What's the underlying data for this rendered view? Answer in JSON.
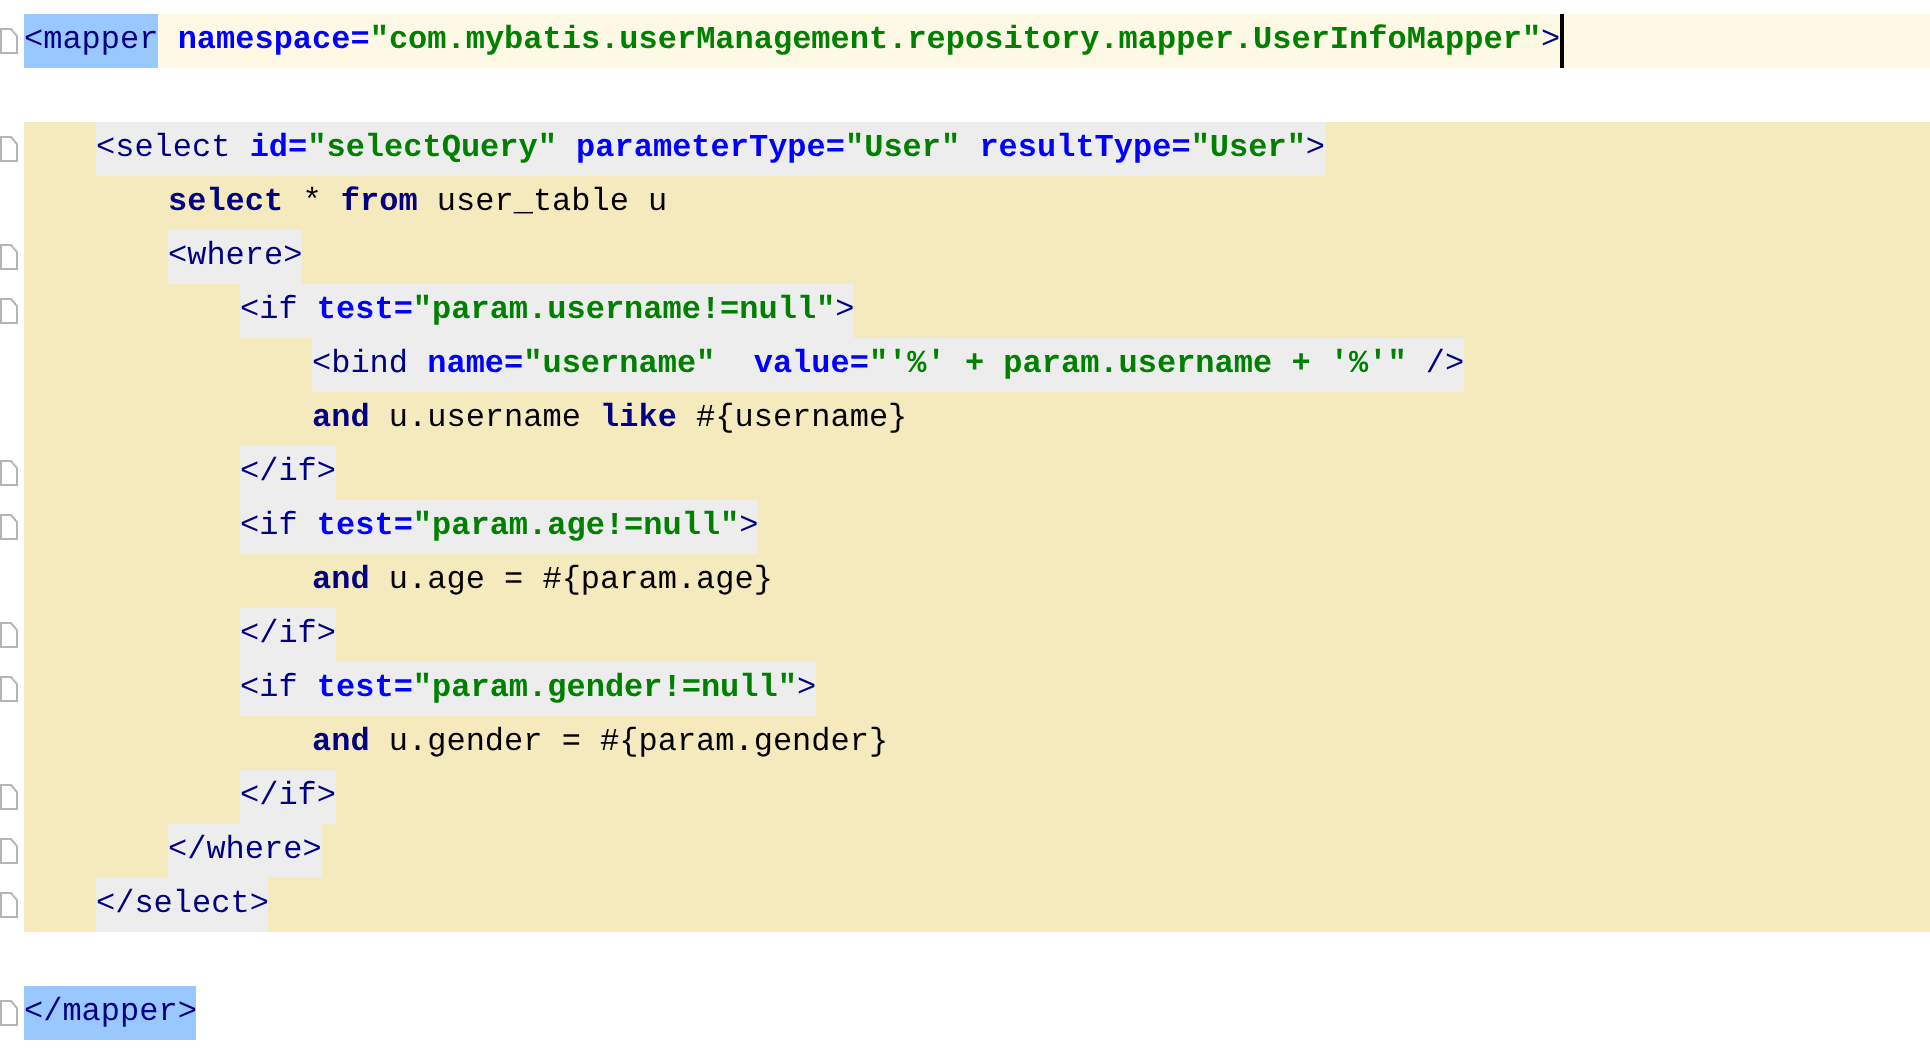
{
  "lines": [
    {
      "current": true,
      "block": false,
      "fold_marker": true,
      "caret": true,
      "matched": true,
      "tokens": [
        {
          "kind": "tag",
          "text": "<mapper"
        },
        {
          "kind": "attr",
          "text": " namespace="
        },
        {
          "kind": "string",
          "text": "\"com.mybatis.userManagement.repository.mapper.UserInfoMapper\""
        },
        {
          "kind": "tag",
          "text": ">"
        }
      ],
      "children": [
        {
          "current": false,
          "block": false,
          "fold_marker": false,
          "caret": false
        },
        {
          "current": false,
          "block": true,
          "tag_highlight": true,
          "fold_marker": true,
          "caret": false,
          "matched": false,
          "tokens": [
            {
              "kind": "tag",
              "text": "<select"
            },
            {
              "kind": "attr",
              "text": " id="
            },
            {
              "kind": "string",
              "text": "\"selectQuery\""
            },
            {
              "kind": "attr",
              "text": " parameterType="
            },
            {
              "kind": "string",
              "text": "\"User\""
            },
            {
              "kind": "attr",
              "text": " resultType="
            },
            {
              "kind": "string",
              "text": "\"User\""
            },
            {
              "kind": "tag",
              "text": ">"
            }
          ],
          "children": [
            {
              "current": false,
              "block": true,
              "tag_highlight": false,
              "fold_marker": false,
              "caret": false,
              "matched": false,
              "tokens": [
                {
                  "kind": "keyword",
                  "text": "select"
                },
                {
                  "kind": "text",
                  "text": " * "
                },
                {
                  "kind": "keyword",
                  "text": "from"
                },
                {
                  "kind": "text",
                  "text": " user_table u"
                }
              ]
            },
            {
              "current": false,
              "block": true,
              "tag_highlight": true,
              "fold_marker": true,
              "caret": false,
              "matched": false,
              "tokens": [
                {
                  "kind": "tag",
                  "text": "<where>"
                }
              ],
              "children": [
                {
                  "current": false,
                  "block": true,
                  "tag_highlight": true,
                  "fold_marker": true,
                  "caret": false,
                  "matched": false,
                  "tokens": [
                    {
                      "kind": "tag",
                      "text": "<if"
                    },
                    {
                      "kind": "attr",
                      "text": " test="
                    },
                    {
                      "kind": "string",
                      "text": "\"param.username!=null\""
                    },
                    {
                      "kind": "tag",
                      "text": ">"
                    }
                  ],
                  "children": [
                    {
                      "current": false,
                      "block": true,
                      "tag_highlight": true,
                      "fold_marker": false,
                      "caret": false,
                      "matched": false,
                      "tokens": [
                        {
                          "kind": "tag",
                          "text": "<bind"
                        },
                        {
                          "kind": "attr",
                          "text": " name="
                        },
                        {
                          "kind": "string",
                          "text": "\"username\""
                        },
                        {
                          "kind": "attr",
                          "text": "  value="
                        },
                        {
                          "kind": "string",
                          "text": "\"'%' + param.username + '%'\""
                        },
                        {
                          "kind": "tag",
                          "text": " />"
                        }
                      ]
                    },
                    {
                      "current": false,
                      "block": true,
                      "tag_highlight": false,
                      "fold_marker": false,
                      "caret": false,
                      "matched": false,
                      "tokens": [
                        {
                          "kind": "keyword",
                          "text": "and"
                        },
                        {
                          "kind": "text",
                          "text": " u.username "
                        },
                        {
                          "kind": "keyword",
                          "text": "like"
                        },
                        {
                          "kind": "text",
                          "text": " #{username}"
                        }
                      ]
                    }
                  ]
                },
                {
                  "current": false,
                  "block": true,
                  "tag_highlight": true,
                  "fold_marker": true,
                  "caret": false,
                  "matched": false,
                  "tokens": [
                    {
                      "kind": "tag",
                      "text": "</if>"
                    }
                  ]
                },
                {
                  "current": false,
                  "block": true,
                  "tag_highlight": true,
                  "fold_marker": true,
                  "caret": false,
                  "matched": false,
                  "tokens": [
                    {
                      "kind": "tag",
                      "text": "<if"
                    },
                    {
                      "kind": "attr",
                      "text": " test="
                    },
                    {
                      "kind": "string",
                      "text": "\"param.age!=null\""
                    },
                    {
                      "kind": "tag",
                      "text": ">"
                    }
                  ],
                  "children": [
                    {
                      "current": false,
                      "block": true,
                      "tag_highlight": false,
                      "fold_marker": false,
                      "caret": false,
                      "matched": false,
                      "tokens": [
                        {
                          "kind": "keyword",
                          "text": "and"
                        },
                        {
                          "kind": "text",
                          "text": " u.age = #{param.age}"
                        }
                      ]
                    }
                  ]
                },
                {
                  "current": false,
                  "block": true,
                  "tag_highlight": true,
                  "fold_marker": true,
                  "caret": false,
                  "matched": false,
                  "tokens": [
                    {
                      "kind": "tag",
                      "text": "</if>"
                    }
                  ]
                },
                {
                  "current": false,
                  "block": true,
                  "tag_highlight": true,
                  "fold_marker": true,
                  "caret": false,
                  "matched": false,
                  "tokens": [
                    {
                      "kind": "tag",
                      "text": "<if"
                    },
                    {
                      "kind": "attr",
                      "text": " test="
                    },
                    {
                      "kind": "string",
                      "text": "\"param.gender!=null\""
                    },
                    {
                      "kind": "tag",
                      "text": ">"
                    }
                  ],
                  "children": [
                    {
                      "current": false,
                      "block": true,
                      "tag_highlight": false,
                      "fold_marker": false,
                      "caret": false,
                      "matched": false,
                      "tokens": [
                        {
                          "kind": "keyword",
                          "text": "and"
                        },
                        {
                          "kind": "text",
                          "text": " u.gender = #{param.gender}"
                        }
                      ]
                    }
                  ]
                },
                {
                  "current": false,
                  "block": true,
                  "tag_highlight": true,
                  "fold_marker": true,
                  "caret": false,
                  "matched": false,
                  "tokens": [
                    {
                      "kind": "tag",
                      "text": "</if>"
                    }
                  ]
                }
              ]
            },
            {
              "current": false,
              "block": true,
              "tag_highlight": true,
              "fold_marker": true,
              "caret": false,
              "matched": false,
              "tokens": [
                {
                  "kind": "tag",
                  "text": "</where>"
                }
              ]
            }
          ]
        },
        {
          "current": false,
          "block": true,
          "tag_highlight": true,
          "fold_marker": true,
          "caret": false,
          "matched": false,
          "tokens": [
            {
              "kind": "tag",
              "text": "</select>"
            }
          ]
        },
        {
          "current": false,
          "block": false,
          "fold_marker": false,
          "caret": false
        }
      ]
    },
    {
      "current": false,
      "block": false,
      "fold_marker": true,
      "caret": false,
      "matched": true,
      "tokens": [
        {
          "kind": "tag",
          "text": "</mapper>"
        }
      ]
    }
  ]
}
